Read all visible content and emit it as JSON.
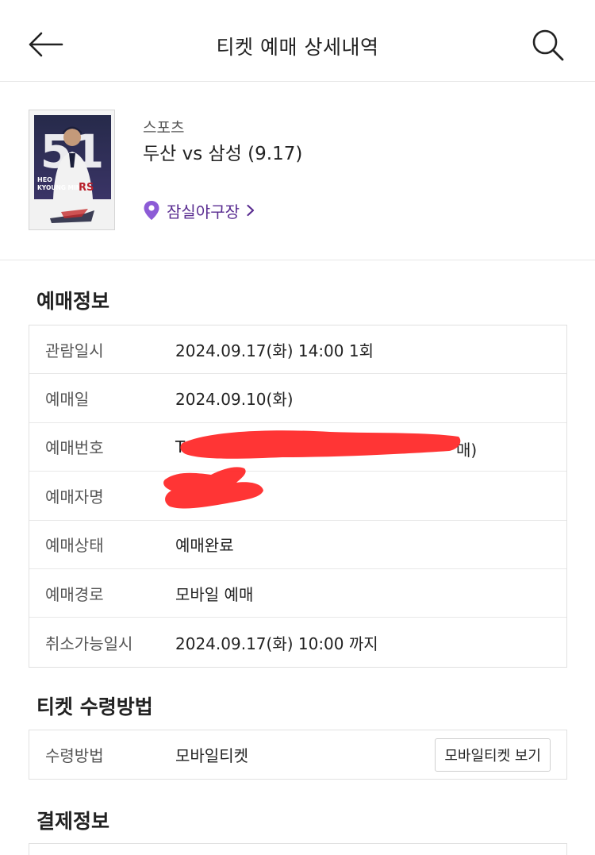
{
  "header": {
    "title": "티켓 예매 상세내역"
  },
  "event": {
    "category": "스포츠",
    "title": "두산 vs 삼성 (9.17)",
    "venue": "잠실야구장",
    "poster": {
      "player_number": "51",
      "player_name_line1": "HEO",
      "player_name_line2": "KYOUNG MIN",
      "jersey_text": "RS"
    },
    "accent_color": "#5a2d91"
  },
  "reservation": {
    "section_title": "예매정보",
    "rows": [
      {
        "label": "관람일시",
        "value": "2024.09.17(화) 14:00 1회"
      },
      {
        "label": "예매일",
        "value": "2024.09.10(화)"
      },
      {
        "label": "예매번호",
        "value_prefix": "T",
        "value_suffix": "매)"
      },
      {
        "label": "예매자명",
        "value": ""
      },
      {
        "label": "예매상태",
        "value": "예매완료"
      },
      {
        "label": "예매경로",
        "value": "모바일 예매"
      },
      {
        "label": "취소가능일시",
        "value": "2024.09.17(화) 10:00 까지"
      }
    ]
  },
  "receive": {
    "section_title": "티켓 수령방법",
    "label": "수령방법",
    "value": "모바일티켓",
    "button_label": "모바일티켓 보기"
  },
  "payment": {
    "section_title": "결제정보"
  },
  "icons": {
    "back": "arrow-left-icon",
    "search": "search-icon",
    "venue": "location-pin-icon",
    "chevron": "chevron-right-icon"
  }
}
